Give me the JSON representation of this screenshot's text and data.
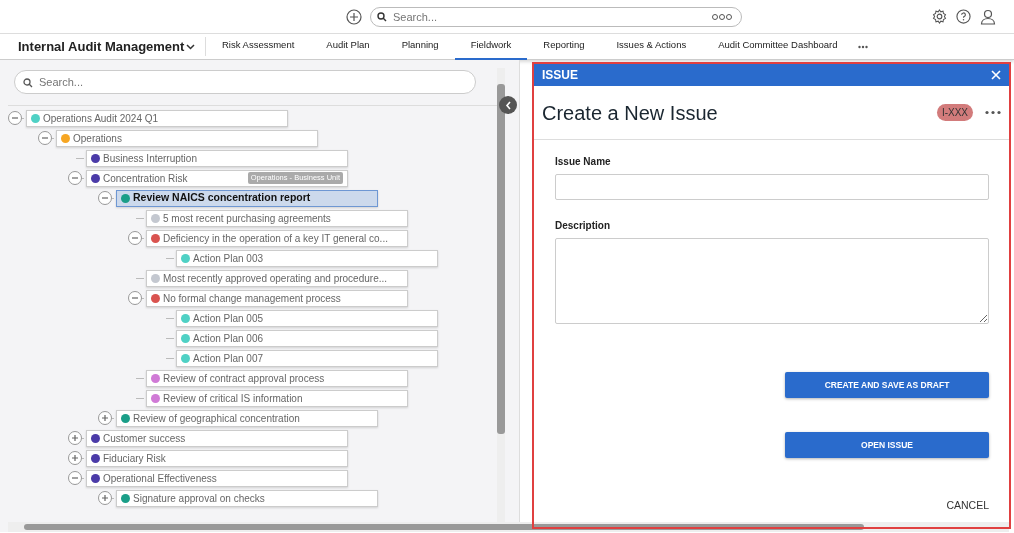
{
  "topbar": {
    "search": {
      "placeholder": "Search..."
    }
  },
  "app_menu": {
    "title": "Internal Audit Management"
  },
  "nav_tabs": [
    {
      "label": "Risk Assessment",
      "selected": false
    },
    {
      "label": "Audit Plan",
      "selected": false
    },
    {
      "label": "Planning",
      "selected": false
    },
    {
      "label": "Fieldwork",
      "selected": true
    },
    {
      "label": "Reporting",
      "selected": false
    },
    {
      "label": "Issues & Actions",
      "selected": false
    },
    {
      "label": "Audit Committee Dashboard",
      "selected": false
    }
  ],
  "tree_panel": {
    "search": {
      "placeholder": "Search..."
    },
    "nodes": [
      {
        "label": "Operations Audit 2024 Q1",
        "color": "#4fd1c5",
        "expanded": true,
        "selected": false,
        "children": [
          {
            "label": "Operations",
            "color": "#f6a623",
            "expanded": true,
            "selected": false,
            "children": [
              {
                "label": "Business Interruption",
                "color": "#4b3ba8",
                "selected": false
              },
              {
                "label": "Concentration Risk",
                "color": "#4b3ba8",
                "expanded": true,
                "selected": false,
                "tag": "Operations - Business Unit",
                "children": [
                  {
                    "label": "Review NAICS concentration report",
                    "color": "#1a9e88",
                    "expanded": true,
                    "selected": true,
                    "children": [
                      {
                        "label": "5 most recent purchasing agreements",
                        "color": "#c4c8d0",
                        "selected": false
                      },
                      {
                        "label": "Deficiency in the operation of a key IT general co...",
                        "color": "#d9534f",
                        "expanded": true,
                        "selected": false,
                        "children": [
                          {
                            "label": "Action Plan 003",
                            "color": "#4fd1c5",
                            "selected": false
                          }
                        ]
                      },
                      {
                        "label": "Most recently approved operating and procedure...",
                        "color": "#c4c8d0",
                        "selected": false
                      },
                      {
                        "label": "No formal change management process",
                        "color": "#d9534f",
                        "expanded": true,
                        "selected": false,
                        "children": [
                          {
                            "label": "Action Plan 005",
                            "color": "#4fd1c5",
                            "selected": false
                          },
                          {
                            "label": "Action Plan 006",
                            "color": "#4fd1c5",
                            "selected": false
                          },
                          {
                            "label": "Action Plan 007",
                            "color": "#4fd1c5",
                            "selected": false
                          }
                        ]
                      },
                      {
                        "label": "Review of contract approval process",
                        "color": "#d07ad6",
                        "selected": false
                      },
                      {
                        "label": "Review of critical IS information",
                        "color": "#d07ad6",
                        "selected": false
                      }
                    ]
                  },
                  {
                    "label": "Review of geographical concentration",
                    "color": "#1a9e88",
                    "expanded": false,
                    "selected": false
                  }
                ]
              },
              {
                "label": "Customer success",
                "color": "#4b3ba8",
                "expanded": false,
                "selected": false
              },
              {
                "label": "Fiduciary Risk",
                "color": "#4b3ba8",
                "expanded": false,
                "selected": false
              },
              {
                "label": "Operational Effectiveness",
                "color": "#4b3ba8",
                "expanded": true,
                "selected": false,
                "children": [
                  {
                    "label": "Signature approval on checks",
                    "color": "#1a9e88",
                    "expanded": false,
                    "selected": false
                  }
                ]
              }
            ]
          }
        ]
      }
    ]
  },
  "issue_panel": {
    "header": "ISSUE",
    "title": "Create a New Issue",
    "badge": "I-XXX",
    "fields": [
      {
        "label": "Issue Name",
        "kind": "input"
      },
      {
        "label": "Description",
        "kind": "textarea"
      }
    ],
    "buttons": [
      "CREATE AND SAVE AS DRAFT",
      "OPEN ISSUE"
    ],
    "cancel": "CANCEL"
  }
}
